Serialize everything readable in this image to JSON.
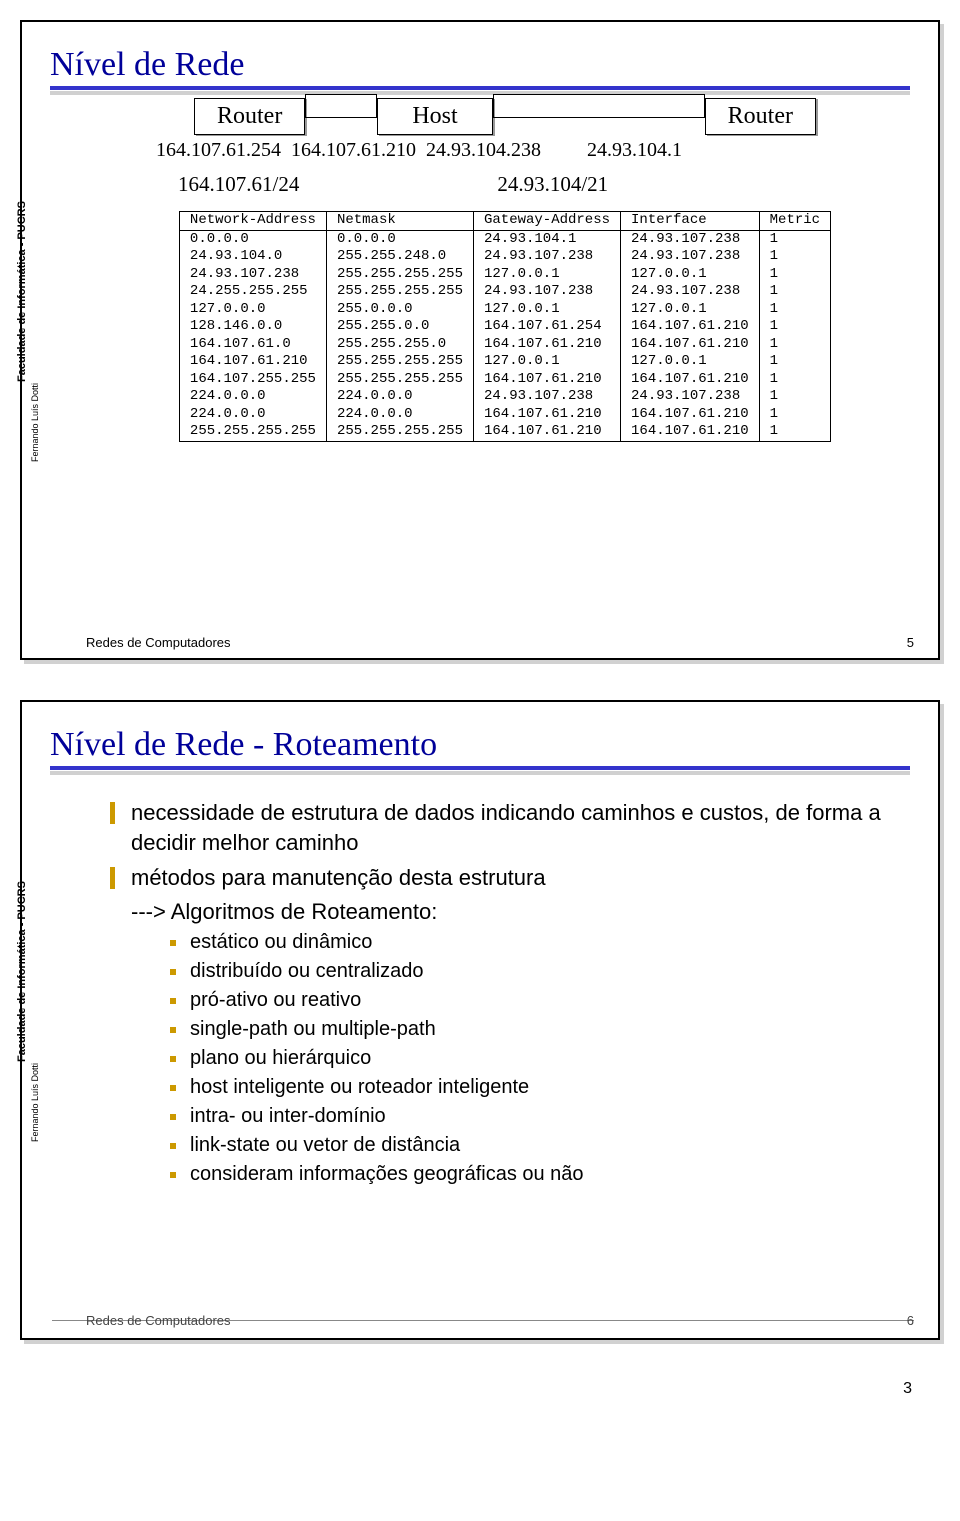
{
  "sidebar": {
    "institution": "Faculdade de Informática - PUCRS",
    "author": "Fernando Luís Dotti"
  },
  "footer_label": "Redes de Computadores",
  "slide1": {
    "title": "Nível de Rede",
    "page_num": "5",
    "nodes": {
      "router_left": "Router",
      "host": "Host",
      "router_right": "Router"
    },
    "ips": {
      "r1_right": "164.107.61.254",
      "host_left": "164.107.61.210",
      "host_right": "24.93.104.238",
      "r2_left": "24.93.104.1"
    },
    "subnets": {
      "left": "164.107.61/24",
      "right": "24.93.104/21"
    },
    "table": {
      "headers": [
        "Network-Address",
        "Netmask",
        "Gateway-Address",
        "Interface",
        "Metric"
      ],
      "rows": [
        [
          "0.0.0.0",
          "0.0.0.0",
          "24.93.104.1",
          "24.93.107.238",
          "1"
        ],
        [
          "24.93.104.0",
          "255.255.248.0",
          "24.93.107.238",
          "24.93.107.238",
          "1"
        ],
        [
          "24.93.107.238",
          "255.255.255.255",
          "127.0.0.1",
          "127.0.0.1",
          "1"
        ],
        [
          "24.255.255.255",
          "255.255.255.255",
          "24.93.107.238",
          "24.93.107.238",
          "1"
        ],
        [
          "127.0.0.0",
          "255.0.0.0",
          "127.0.0.1",
          "127.0.0.1",
          "1"
        ],
        [
          "128.146.0.0",
          "255.255.0.0",
          "164.107.61.254",
          "164.107.61.210",
          "1"
        ],
        [
          "164.107.61.0",
          "255.255.255.0",
          "164.107.61.210",
          "164.107.61.210",
          "1"
        ],
        [
          "164.107.61.210",
          "255.255.255.255",
          "127.0.0.1",
          "127.0.0.1",
          "1"
        ],
        [
          "164.107.255.255",
          "255.255.255.255",
          "164.107.61.210",
          "164.107.61.210",
          "1"
        ],
        [
          "224.0.0.0",
          "224.0.0.0",
          "24.93.107.238",
          "24.93.107.238",
          "1"
        ],
        [
          "224.0.0.0",
          "224.0.0.0",
          "164.107.61.210",
          "164.107.61.210",
          "1"
        ],
        [
          "255.255.255.255",
          "255.255.255.255",
          "164.107.61.210",
          "164.107.61.210",
          "1"
        ]
      ]
    }
  },
  "slide2": {
    "title": "Nível de Rede - Roteamento",
    "page_num": "6",
    "b1_1": "necessidade de estrutura de dados indicando caminhos e custos, de forma a decidir melhor caminho",
    "b1_2": "métodos para manutenção desta estrutura",
    "b1_2_sub": "---> Algoritmos de Roteamento:",
    "b2": [
      "estático ou dinâmico",
      "distribuído ou centralizado",
      "pró-ativo ou reativo",
      "single-path ou multiple-path",
      "plano ou hierárquico",
      "host inteligente ou roteador inteligente",
      "intra- ou inter-domínio",
      "link-state ou vetor de distância",
      "consideram informações geográficas ou não"
    ]
  },
  "bottom_page": "3"
}
